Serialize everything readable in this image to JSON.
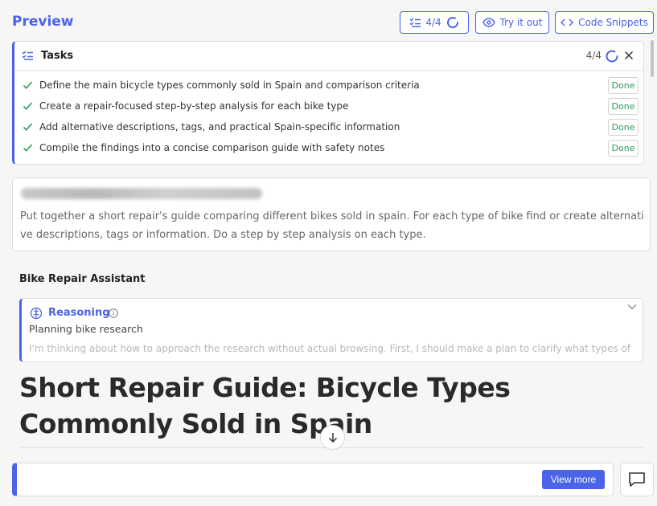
{
  "header": {
    "title": "Preview",
    "tasks_counter": "4/4",
    "try_label": "Try it out",
    "code_label": "Code Snippets"
  },
  "tasks": {
    "title": "Tasks",
    "counter": "4/4",
    "items": [
      {
        "text": "Define the main bicycle types commonly sold in Spain and comparison criteria",
        "status": "Done"
      },
      {
        "text": "Create a repair-focused step-by-step analysis for each bike type",
        "status": "Done"
      },
      {
        "text": "Add alternative descriptions, tags, and practical Spain-specific information",
        "status": "Done"
      },
      {
        "text": "Compile the findings into a concise comparison guide with safety notes",
        "status": "Done"
      }
    ]
  },
  "prompt": {
    "text": "Put together a short repair's guide comparing different bikes sold in spain. For each type of bike find or create alternative descriptions, tags or information. Do a step by step analysis on each type."
  },
  "assistant": {
    "name": "Bike Repair Assistant",
    "reasoning_label": "Reasoning",
    "reasoning_subtitle": "Planning bike research",
    "reasoning_preview": "I'm thinking about how to approach the research without actual browsing. First, I should make a plan to clarify what types of",
    "heading": "Short Repair Guide: Bicycle Types Commonly Sold in Spain"
  },
  "footer": {
    "view_more": "View more"
  },
  "colors": {
    "accent": "#4a63e7",
    "done_green": "#2d9a5e"
  },
  "icons": [
    "checklist-icon",
    "spinner-icon",
    "eye-icon",
    "code-icon",
    "close-icon",
    "check-icon",
    "brain-icon",
    "info-icon",
    "chevron-down-icon",
    "arrow-down-icon",
    "chat-icon"
  ]
}
